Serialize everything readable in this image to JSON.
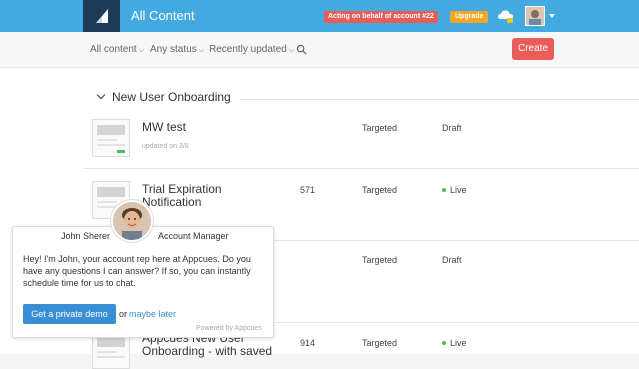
{
  "header": {
    "title": "All Content",
    "acting_badge": "Acting on behalf of account #22",
    "upgrade_label": "Upgrade",
    "bg_color": "#42aae0",
    "logo_bg_color": "#1f3a55"
  },
  "filters": {
    "all_content": "All content",
    "any_status": "Any status",
    "recently_updated": "Recently updated",
    "create_label": "Create"
  },
  "group": {
    "name": "New User Onboarding"
  },
  "items": [
    {
      "name": "MW test",
      "subtext": "updated on 3/8",
      "count": "",
      "targeting": "Targeted",
      "status": "Draft",
      "live": false
    },
    {
      "name": "Trial Expiration Notification",
      "subtext": "",
      "count": "571",
      "targeting": "Targeted",
      "status": "Live",
      "live": true
    },
    {
      "name": "",
      "subtext": "",
      "count": "",
      "targeting": "Targeted",
      "status": "Draft",
      "live": false
    },
    {
      "name": "Appcues New User Onboarding - with saved",
      "subtext": "",
      "count": "914",
      "targeting": "Targeted",
      "status": "Live",
      "live": true
    }
  ],
  "chat": {
    "name": "John Sherer",
    "role": "Account Manager",
    "message": "Hey! I'm John, your account rep here at Appcues. Do you have any questions I can answer? If so, you can instantly schedule time for us to chat.",
    "demo_label": "Get a private demo",
    "or_text": "or",
    "later_label": "maybe later",
    "powered_by": "Powered by Appcues"
  },
  "colors": {
    "create": "#e85d5a",
    "live": "#4cbe5a",
    "link": "#3a8fd4"
  }
}
